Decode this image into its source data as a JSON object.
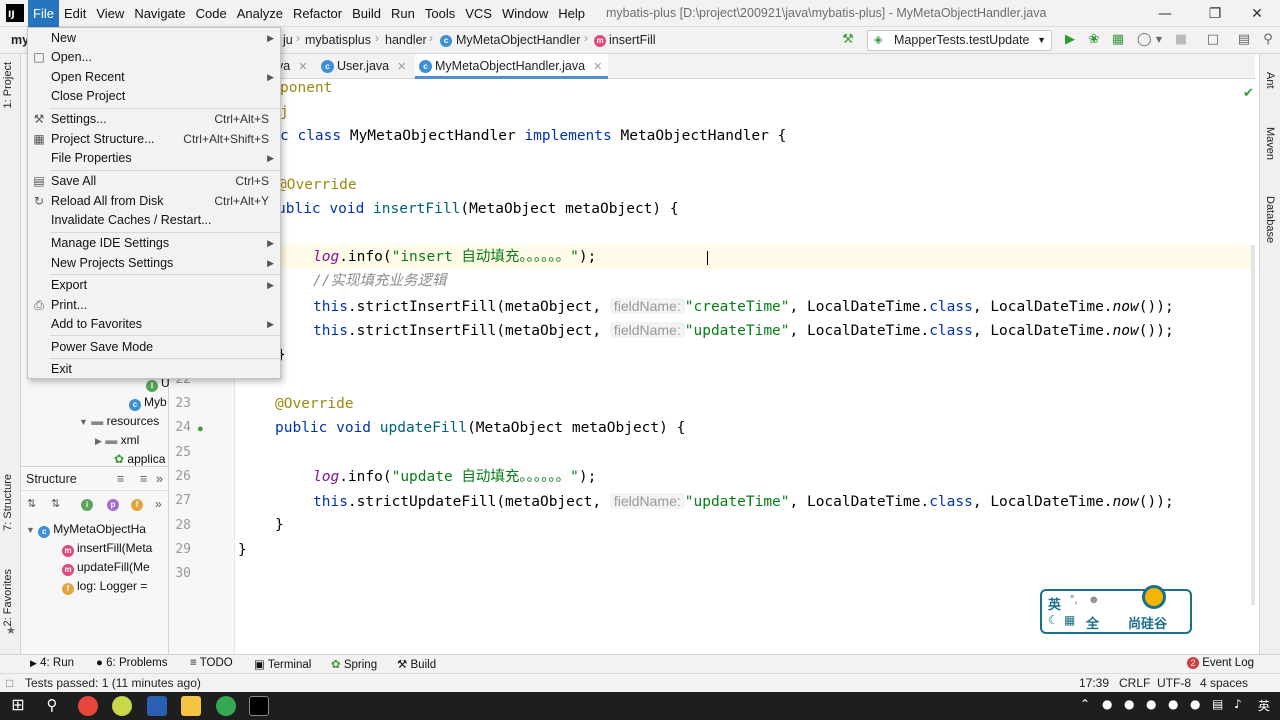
{
  "menubar": {
    "items": [
      "File",
      "Edit",
      "View",
      "Navigate",
      "Code",
      "Analyze",
      "Refactor",
      "Build",
      "Run",
      "Tools",
      "VCS",
      "Window",
      "Help"
    ],
    "title": "mybatis-plus [D:\\project\\200921\\java\\mybatis-plus] - MyMetaObjectHandler.java"
  },
  "navbar": {
    "project_short": "my",
    "crumbs": [
      "ju",
      "mybatisplus",
      "handler",
      "MyMetaObjectHandler",
      "insertFill"
    ],
    "run_config": "MapperTests.testUpdate"
  },
  "tabs": [
    "va",
    "User.java",
    "MyMetaObjectHandler.java"
  ],
  "file_menu": {
    "items": [
      {
        "label": "New",
        "shortcut": "",
        "submenu": true
      },
      {
        "label": "Open...",
        "shortcut": "",
        "submenu": false
      },
      {
        "label": "Open Recent",
        "shortcut": "",
        "submenu": true
      },
      {
        "label": "Close Project",
        "shortcut": "",
        "submenu": false
      },
      {
        "label": "Settings...",
        "shortcut": "Ctrl+Alt+S",
        "submenu": false
      },
      {
        "label": "Project Structure...",
        "shortcut": "Ctrl+Alt+Shift+S",
        "submenu": false
      },
      {
        "label": "File Properties",
        "shortcut": "",
        "submenu": true
      },
      {
        "label": "Save All",
        "shortcut": "Ctrl+S",
        "submenu": false
      },
      {
        "label": "Reload All from Disk",
        "shortcut": "Ctrl+Alt+Y",
        "submenu": false
      },
      {
        "label": "Invalidate Caches / Restart...",
        "shortcut": "",
        "submenu": false
      },
      {
        "label": "Manage IDE Settings",
        "shortcut": "",
        "submenu": true
      },
      {
        "label": "New Projects Settings",
        "shortcut": "",
        "submenu": true
      },
      {
        "label": "Export",
        "shortcut": "",
        "submenu": true
      },
      {
        "label": "Print...",
        "shortcut": "",
        "submenu": false
      },
      {
        "label": "Add to Favorites",
        "shortcut": "",
        "submenu": true
      },
      {
        "label": "Power Save Mode",
        "shortcut": "",
        "submenu": false
      },
      {
        "label": "Exit",
        "shortcut": "",
        "submenu": false
      }
    ]
  },
  "left_strip": {
    "project": "1: Project",
    "structure": "7: Structure",
    "favorites": "2: Favorites"
  },
  "right_strip": {
    "ant": "Ant",
    "maven": "Maven",
    "database": "Database"
  },
  "project_tree": {
    "rows": [
      "U",
      "Myb",
      "resources",
      "xml",
      "applica"
    ]
  },
  "structure": {
    "title": "Structure",
    "rows": [
      "MyMetaObjectHa",
      "insertFill(Meta",
      "updateFill(Me",
      "log: Logger ="
    ]
  },
  "gutter": {
    "line_numbers": [
      "22",
      "23",
      "24",
      "25",
      "26",
      "27",
      "28",
      "29",
      "30"
    ]
  },
  "code": {
    "l1": "ponent",
    "l2": "j",
    "l3a": "c class ",
    "l3b": "MyMetaObjectHandler ",
    "l3c": "implements ",
    "l3d": "MetaObjectHandler {",
    "l5": "@Override",
    "l6a": "ublic void ",
    "l6b": "insertFill",
    "l6c": "(MetaObject metaObject) {",
    "l8a": "log",
    "l8b": ".info(",
    "l8c": "\"insert 自动填充。。。。。。\"",
    "l8d": ");",
    "l9": "//实现填充业务逻辑",
    "l10a": "this",
    "l10b": ".strictInsertFill(metaObject, ",
    "hint": "fieldName:",
    "l10c": "\"createTime\"",
    "l10d": ", LocalDateTime.",
    "l10e": "class",
    "l10f": ", LocalDateTime.",
    "l10g": "now",
    "l10h": "());",
    "l11c": "\"updateTime\"",
    "l12": "}",
    "l14": "@Override",
    "l15a": "public void ",
    "l15b": "updateFill",
    "l15c": "(MetaObject metaObject) {",
    "l17c": "\"update 自动填充。。。。。。\"",
    "l18b": ".strictUpdateFill(metaObject, ",
    "l19": "}",
    "l20": "}"
  },
  "bottom_tools": [
    "4: Run",
    "6: Problems",
    "TODO",
    "Terminal",
    "Spring",
    "Build",
    "Event Log"
  ],
  "event_count": "2",
  "status": {
    "message": "Tests passed: 1 (11 minutes ago)",
    "position": "17:39",
    "line_sep": "CRLF",
    "encoding": "UTF-8",
    "indent": "4 spaces"
  },
  "ime": {
    "lang": "英",
    "full": "全",
    "brand": "尚硅谷"
  },
  "taskbar": {
    "tray_lang": "英"
  },
  "colors": {
    "accent": "#2675bf",
    "keyword": "#0033b3",
    "string": "#067d17",
    "annotation": "#9e880d"
  }
}
